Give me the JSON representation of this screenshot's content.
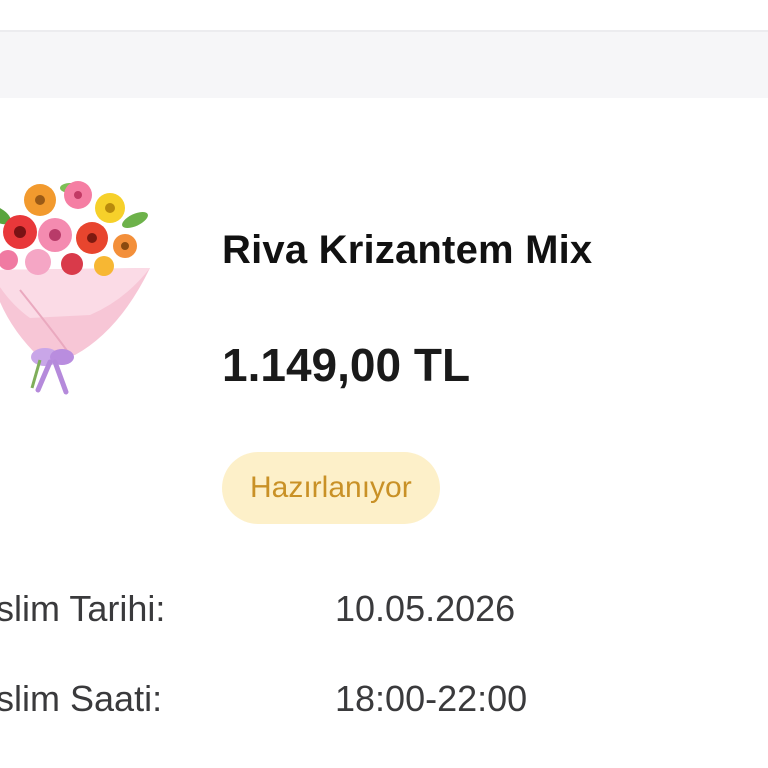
{
  "product": {
    "name": "Riva Krizantem Mix",
    "price": "1.149,00 TL",
    "status": "Hazırlanıyor",
    "image_icon": "flower-bouquet"
  },
  "details": [
    {
      "label": "Teslim Tarihi:",
      "value": "10.05.2026"
    },
    {
      "label": "Teslim Saati:",
      "value": "18:00-22:00"
    }
  ],
  "colors": {
    "status_badge_bg": "#fdf0c9",
    "status_badge_text": "#c99126",
    "header_bg": "#f6f6f8"
  }
}
